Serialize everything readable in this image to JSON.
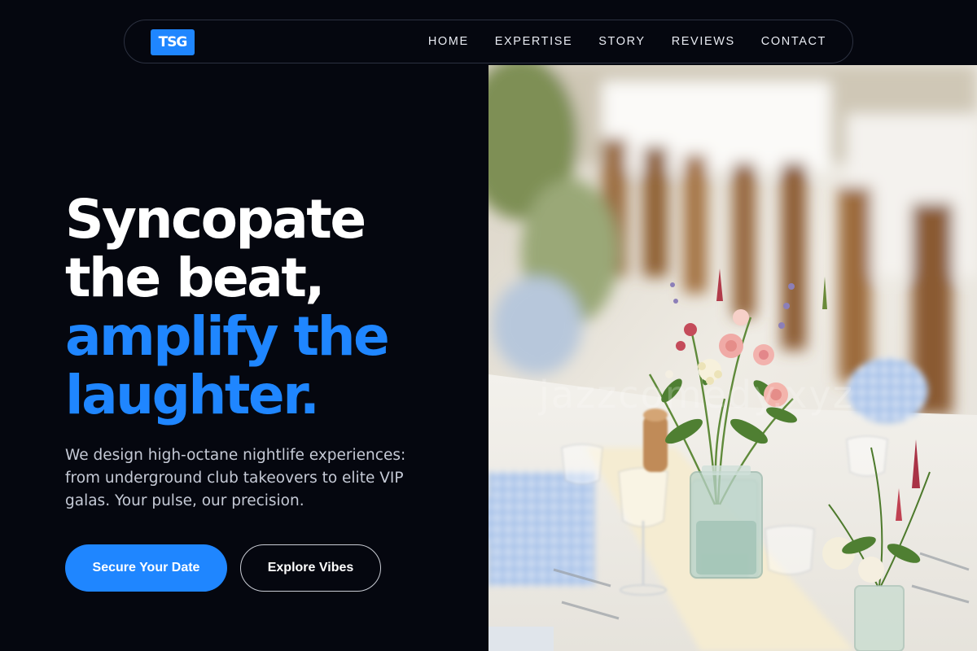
{
  "brand": {
    "logo_text": "TSG",
    "accent_color": "#1f86ff",
    "background_color": "#05070f"
  },
  "nav": {
    "items": [
      {
        "label": "HOME"
      },
      {
        "label": "EXPERTISE"
      },
      {
        "label": "STORY"
      },
      {
        "label": "REVIEWS"
      },
      {
        "label": "CONTACT"
      }
    ]
  },
  "hero": {
    "headline_white_1": "Syncopate",
    "headline_white_2": "the beat,",
    "headline_blue_1": "amplify the",
    "headline_blue_2": "laughter.",
    "lead": "We design high-octane nightlife experiences: from underground club takeovers to elite VIP galas. Your pulse, our precision.",
    "primary_cta": "Secure Your Date",
    "secondary_cta": "Explore Vibes",
    "image_watermark": "jazzcomedy.xyz"
  }
}
